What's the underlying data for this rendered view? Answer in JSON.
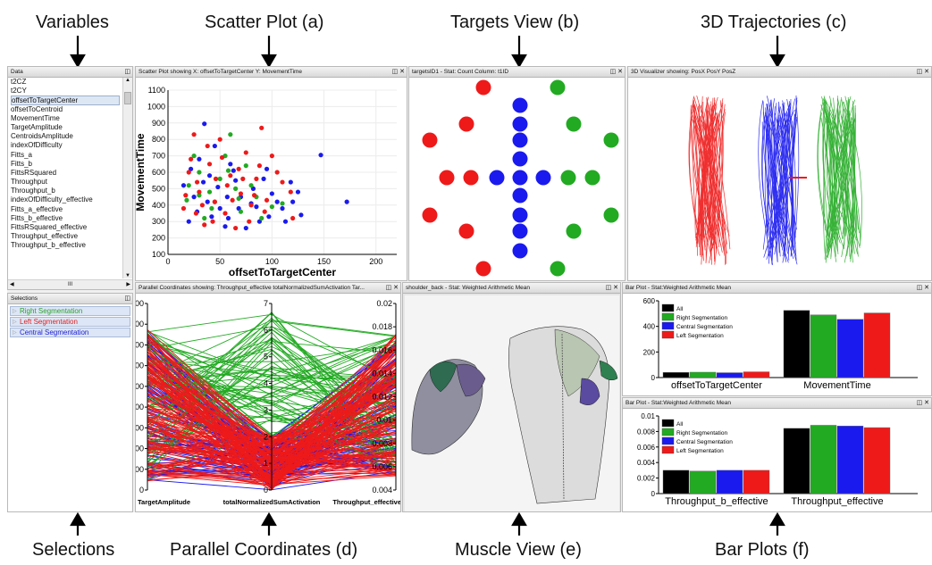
{
  "annotations": {
    "variables": "Variables",
    "scatter": "Scatter Plot (a)",
    "targets": "Targets View (b)",
    "trajectories": "3D Trajectories (c)",
    "selections": "Selections",
    "parallel": "Parallel Coordinates (d)",
    "muscle": "Muscle View (e)",
    "barplots": "Bar Plots (f)"
  },
  "data_panel": {
    "title": "Data",
    "items": [
      "t2CZ",
      "t2CY",
      "offsetToTargetCenter",
      "offsetToCentroid",
      "MovementTime",
      "TargetAmplitude",
      "CentroidsAmplitude",
      "indexOfDifficulty",
      "Fitts_a",
      "Fitts_b",
      "FittsRSquared",
      "Throughput",
      "Throughput_b",
      "indexOfDifficulty_effective",
      "Fitts_a_effective",
      "Fitts_b_effective",
      "FittsRSquared_effective",
      "Throughput_effective",
      "Throughput_b_effective"
    ],
    "selected": "offsetToTargetCenter",
    "hscroll_label": "III"
  },
  "selections_panel": {
    "title": "Selections",
    "items": [
      {
        "label": "Right Segmentation",
        "color": "#2ca02c"
      },
      {
        "label": "Left Segmentation",
        "color": "#e02020"
      },
      {
        "label": "Central Segmentation",
        "color": "#2020d0"
      }
    ]
  },
  "scatter_panel": {
    "title": "Scatter Plot showing X: offsetToTargetCenter Y: MovementTime"
  },
  "targets_panel": {
    "title": "targetsID1 - Stat: Count Column: t1ID"
  },
  "traj_panel": {
    "title": "3D Visualizer showing: PosX PosY PosZ"
  },
  "parallel_panel": {
    "title": "Parallel Coordinates showing: Throughput_effective totalNormalizedSumActivation Tar..."
  },
  "muscle_panel": {
    "title": "shoulder_back - Stat: Weighted Arithmetic Mean"
  },
  "bar1_panel": {
    "title": "Bar Plot - Stat:Weighted Arithmetic Mean"
  },
  "bar2_panel": {
    "title": "Bar Plot - Stat:Weighted Arithmetic Mean"
  },
  "colors": {
    "all": "#000000",
    "right": "#22aa22",
    "central": "#1a1aee",
    "left": "#ee1a1a"
  },
  "chart_data": [
    {
      "type": "scatter",
      "xlabel": "offsetToTargetCenter",
      "ylabel": "MovementTime",
      "xlim": [
        0,
        220
      ],
      "ylim": [
        100,
        1100
      ],
      "xticks": [
        0,
        50,
        100,
        150,
        200
      ],
      "yticks": [
        100,
        200,
        300,
        400,
        500,
        600,
        700,
        800,
        900,
        1000,
        1100
      ],
      "series": [
        {
          "color_key": "central",
          "points": [
            [
              35,
              895
            ],
            [
              147,
              705
            ],
            [
              172,
              420
            ],
            [
              118,
              540
            ],
            [
              128,
              340
            ],
            [
              95,
              620
            ],
            [
              30,
              680
            ],
            [
              60,
              650
            ],
            [
              82,
              500
            ],
            [
              55,
              270
            ],
            [
              20,
              300
            ],
            [
              40,
              580
            ],
            [
              70,
              450
            ],
            [
              105,
              420
            ],
            [
              125,
              480
            ],
            [
              88,
              300
            ],
            [
              110,
              380
            ],
            [
              50,
              380
            ],
            [
              25,
              450
            ],
            [
              65,
              550
            ],
            [
              45,
              760
            ],
            [
              15,
              520
            ],
            [
              75,
              260
            ],
            [
              92,
              560
            ],
            [
              100,
              470
            ],
            [
              58,
              320
            ],
            [
              38,
              420
            ],
            [
              28,
              360
            ],
            [
              68,
              380
            ],
            [
              48,
              510
            ],
            [
              80,
              410
            ],
            [
              113,
              300
            ],
            [
              63,
              610
            ],
            [
              34,
              540
            ],
            [
              22,
              620
            ],
            [
              42,
              330
            ],
            [
              57,
              450
            ],
            [
              85,
              390
            ],
            [
              97,
              330
            ],
            [
              120,
              420
            ]
          ]
        },
        {
          "color_key": "right",
          "points": [
            [
              60,
              830
            ],
            [
              30,
              600
            ],
            [
              55,
              700
            ],
            [
              75,
              640
            ],
            [
              40,
              480
            ],
            [
              65,
              500
            ],
            [
              18,
              430
            ],
            [
              100,
              390
            ],
            [
              45,
              420
            ],
            [
              85,
              450
            ],
            [
              25,
              700
            ],
            [
              50,
              560
            ],
            [
              70,
              360
            ],
            [
              35,
              320
            ],
            [
              110,
              410
            ],
            [
              80,
              520
            ],
            [
              20,
              520
            ],
            [
              90,
              320
            ],
            [
              58,
              610
            ],
            [
              42,
              380
            ],
            [
              68,
              440
            ],
            [
              30,
              460
            ]
          ]
        },
        {
          "color_key": "left",
          "points": [
            [
              25,
              830
            ],
            [
              50,
              800
            ],
            [
              90,
              870
            ],
            [
              75,
              720
            ],
            [
              40,
              650
            ],
            [
              100,
              700
            ],
            [
              60,
              580
            ],
            [
              20,
              600
            ],
            [
              85,
              560
            ],
            [
              110,
              540
            ],
            [
              30,
              480
            ],
            [
              70,
              470
            ],
            [
              45,
              420
            ],
            [
              95,
              430
            ],
            [
              55,
              350
            ],
            [
              120,
              320
            ],
            [
              35,
              280
            ],
            [
              65,
              260
            ],
            [
              80,
              400
            ],
            [
              15,
              380
            ],
            [
              105,
              600
            ],
            [
              52,
              690
            ],
            [
              28,
              540
            ],
            [
              62,
              430
            ],
            [
              78,
              300
            ],
            [
              88,
              640
            ],
            [
              38,
              760
            ],
            [
              22,
              680
            ],
            [
              118,
              480
            ],
            [
              46,
              560
            ],
            [
              72,
              560
            ],
            [
              33,
              400
            ],
            [
              57,
              520
            ],
            [
              93,
              360
            ],
            [
              68,
              620
            ],
            [
              43,
              300
            ],
            [
              83,
              460
            ],
            [
              17,
              460
            ],
            [
              27,
              350
            ]
          ]
        }
      ]
    },
    {
      "type": "scatter",
      "title": "targets",
      "points": [
        {
          "x": 540,
          "y": 97,
          "color_key": "left"
        },
        {
          "x": 623,
          "y": 97,
          "color_key": "right"
        },
        {
          "x": 581,
          "y": 117,
          "color_key": "central"
        },
        {
          "x": 521,
          "y": 138,
          "color_key": "left"
        },
        {
          "x": 581,
          "y": 138,
          "color_key": "central"
        },
        {
          "x": 641,
          "y": 138,
          "color_key": "right"
        },
        {
          "x": 480,
          "y": 156,
          "color_key": "left"
        },
        {
          "x": 581,
          "y": 156,
          "color_key": "central"
        },
        {
          "x": 683,
          "y": 156,
          "color_key": "right"
        },
        {
          "x": 581,
          "y": 177,
          "color_key": "central"
        },
        {
          "x": 499,
          "y": 198,
          "color_key": "left"
        },
        {
          "x": 526,
          "y": 198,
          "color_key": "left"
        },
        {
          "x": 555,
          "y": 198,
          "color_key": "central"
        },
        {
          "x": 581,
          "y": 198,
          "color_key": "central"
        },
        {
          "x": 607,
          "y": 198,
          "color_key": "central"
        },
        {
          "x": 635,
          "y": 198,
          "color_key": "right"
        },
        {
          "x": 662,
          "y": 198,
          "color_key": "right"
        },
        {
          "x": 581,
          "y": 218,
          "color_key": "central"
        },
        {
          "x": 480,
          "y": 240,
          "color_key": "left"
        },
        {
          "x": 581,
          "y": 240,
          "color_key": "central"
        },
        {
          "x": 683,
          "y": 240,
          "color_key": "right"
        },
        {
          "x": 521,
          "y": 258,
          "color_key": "left"
        },
        {
          "x": 581,
          "y": 258,
          "color_key": "central"
        },
        {
          "x": 641,
          "y": 258,
          "color_key": "right"
        },
        {
          "x": 581,
          "y": 280,
          "color_key": "central"
        },
        {
          "x": 540,
          "y": 300,
          "color_key": "left"
        },
        {
          "x": 623,
          "y": 300,
          "color_key": "right"
        }
      ]
    },
    {
      "type": "line",
      "title": "parallel-coordinates",
      "axes": [
        {
          "label": "TargetAmplitude",
          "ticks": [
            "0",
            "100",
            "200",
            "300",
            "400",
            "500",
            "600",
            "700",
            "800",
            "900"
          ]
        },
        {
          "label": "totalNormalizedSumActivation",
          "ticks": [
            "0",
            "1",
            "2",
            "3",
            "4",
            "5",
            "6",
            "7"
          ]
        },
        {
          "label": "Throughput_effective",
          "ticks": [
            "0.004",
            "0.006",
            "0.008",
            "0.01",
            "0.012",
            "0.014",
            "0.016",
            "0.018",
            "0.02"
          ]
        }
      ]
    },
    {
      "type": "bar",
      "categories": [
        "offsetToTargetCenter",
        "MovementTime"
      ],
      "series": [
        {
          "name": "All",
          "color_key": "all",
          "values": [
            40,
            525
          ]
        },
        {
          "name": "Right Segmentation",
          "color_key": "right",
          "values": [
            42,
            490
          ]
        },
        {
          "name": "Central Segmentation",
          "color_key": "central",
          "values": [
            38,
            455
          ]
        },
        {
          "name": "Left Segmentation",
          "color_key": "left",
          "values": [
            45,
            505
          ]
        }
      ],
      "ylim": [
        0,
        600
      ],
      "yticks": [
        0,
        200,
        400,
        600
      ],
      "legend": "top-left"
    },
    {
      "type": "bar",
      "categories": [
        "Throughput_b_effective",
        "Throughput_effective"
      ],
      "series": [
        {
          "name": "All",
          "color_key": "all",
          "values": [
            0.003,
            0.0084
          ]
        },
        {
          "name": "Right Segmentation",
          "color_key": "right",
          "values": [
            0.0029,
            0.0088
          ]
        },
        {
          "name": "Central Segmentation",
          "color_key": "central",
          "values": [
            0.003,
            0.0087
          ]
        },
        {
          "name": "Left Segmentation",
          "color_key": "left",
          "values": [
            0.003,
            0.0085
          ]
        }
      ],
      "ylim": [
        0,
        0.01
      ],
      "yticks": [
        "0",
        "0.002",
        "0.004",
        "0.006",
        "0.008",
        "0.01"
      ],
      "legend": "top-left"
    }
  ]
}
